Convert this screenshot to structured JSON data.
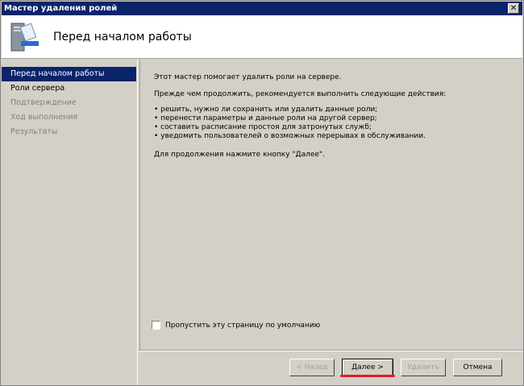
{
  "window": {
    "title": "Мастер удаления ролей",
    "close_label": "✕"
  },
  "header": {
    "title": "Перед началом работы",
    "icon": "server-wizard-icon"
  },
  "sidebar": {
    "items": [
      {
        "label": "Перед началом работы",
        "state": "active"
      },
      {
        "label": "Роли сервера",
        "state": "normal"
      },
      {
        "label": "Подтверждение",
        "state": "disabled"
      },
      {
        "label": "Ход выполнения",
        "state": "disabled"
      },
      {
        "label": "Результаты",
        "state": "disabled"
      }
    ]
  },
  "content": {
    "intro": "Этот мастер помогает удалить роли на сервере.",
    "before": "Прежде чем продолжить, рекомендуется выполнить следующие действия:",
    "bullets": [
      "• решить, нужно ли сохранить или удалить данные роли;",
      "• перенести параметры и данные роли на другой сервер;",
      "• составить расписание простоя для затронутых служб;",
      "• уведомить пользователей о возможных перерывах в обслуживании."
    ],
    "continue": "Для продолжения нажмите кнопку \"Далее\".",
    "skip_label": "Пропустить эту страницу по умолчанию",
    "skip_checked": false
  },
  "buttons": {
    "back": "< Назад",
    "next": "Далее >",
    "remove": "Удалить",
    "cancel": "Отмена"
  },
  "colors": {
    "titlebar": "#0a246a",
    "highlight": "#e0202a"
  }
}
